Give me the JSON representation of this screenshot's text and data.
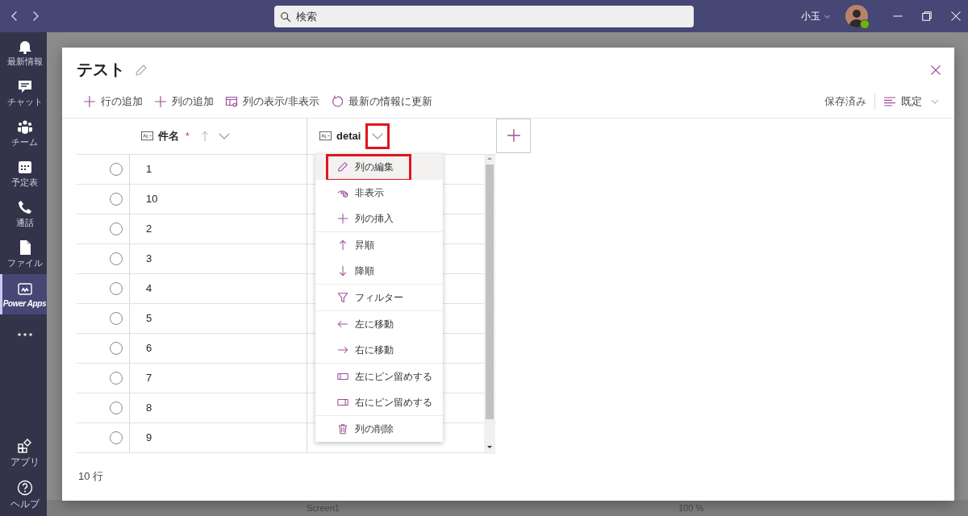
{
  "titlebar": {
    "search": {
      "placeholder": "検索"
    },
    "user": {
      "name": "小玉",
      "online": true
    }
  },
  "sidebar": {
    "items": [
      {
        "label": "最新情報",
        "kind": "bell",
        "selected": false
      },
      {
        "label": "チャット",
        "kind": "chat",
        "selected": false
      },
      {
        "label": "チーム",
        "kind": "teams",
        "selected": false
      },
      {
        "label": "予定表",
        "kind": "calendar",
        "selected": false
      },
      {
        "label": "通話",
        "kind": "phone",
        "selected": false
      },
      {
        "label": "ファイル",
        "kind": "file",
        "selected": false
      },
      {
        "label": "Power Apps",
        "kind": "powerapps",
        "selected": true
      }
    ],
    "bottom_items": [
      {
        "label": "アプリ",
        "kind": "apps",
        "selected": false
      },
      {
        "label": "ヘルプ",
        "kind": "help",
        "selected": false
      }
    ]
  },
  "background": {
    "labels": [
      "Screen1",
      "100 %"
    ]
  },
  "dialog": {
    "title": "テスト",
    "toolbar": [
      {
        "label": "行の追加",
        "kind": "add"
      },
      {
        "label": "列の追加",
        "kind": "add"
      },
      {
        "label": "列の表示/非表示",
        "kind": "columns"
      },
      {
        "label": "最新の情報に更新",
        "kind": "refresh"
      }
    ],
    "save_state": "保存済み",
    "view": "既定",
    "columns": [
      {
        "label": "件名",
        "required_mark": "*",
        "sorted_ascending": true,
        "annotated": false
      },
      {
        "label": "detai",
        "sorted_ascending": false,
        "annotated": true
      }
    ],
    "rows": [
      {
        "title": "1",
        "selected": false
      },
      {
        "title": "10",
        "selected": false
      },
      {
        "title": "2",
        "selected": false
      },
      {
        "title": "3",
        "selected": false
      },
      {
        "title": "4",
        "selected": false
      },
      {
        "title": "5",
        "selected": false
      },
      {
        "title": "6",
        "selected": false
      },
      {
        "title": "7",
        "selected": false
      },
      {
        "title": "8",
        "selected": false
      },
      {
        "title": "9",
        "selected": false
      }
    ],
    "row_count": "10 行",
    "column_menu": {
      "groups": [
        [
          {
            "label": "列の編集",
            "kind": "edit",
            "highlighted": true,
            "annotated": true
          },
          {
            "label": "非表示",
            "kind": "hide",
            "highlighted": false,
            "annotated": false
          },
          {
            "label": "列の挿入",
            "kind": "insert",
            "highlighted": false,
            "annotated": false
          }
        ],
        [
          {
            "label": "昇順",
            "kind": "sort-asc",
            "highlighted": false,
            "annotated": false
          },
          {
            "label": "降順",
            "kind": "sort-desc",
            "highlighted": false,
            "annotated": false
          }
        ],
        [
          {
            "label": "フィルター",
            "kind": "filter",
            "highlighted": false,
            "annotated": false
          }
        ],
        [
          {
            "label": "左に移動",
            "kind": "move-left",
            "highlighted": false,
            "annotated": false
          },
          {
            "label": "右に移動",
            "kind": "move-right",
            "highlighted": false,
            "annotated": false
          }
        ],
        [
          {
            "label": "左にピン留めする",
            "kind": "pin-left",
            "highlighted": false,
            "annotated": false
          },
          {
            "label": "右にピン留めする",
            "kind": "pin-right",
            "highlighted": false,
            "annotated": false
          }
        ],
        [
          {
            "label": "列の削除",
            "kind": "delete",
            "highlighted": false,
            "annotated": false
          }
        ]
      ]
    }
  }
}
